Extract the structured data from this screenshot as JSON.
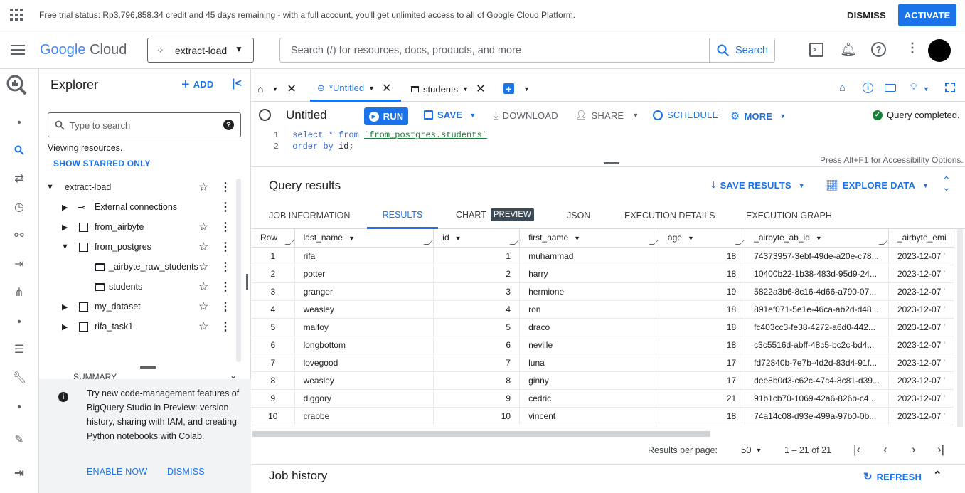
{
  "trial": {
    "text": "Free trial status: Rp3,796,858.34 credit and 45 days remaining - with a full account, you'll get unlimited access to all of Google Cloud Platform.",
    "dismiss": "DISMISS",
    "activate": "ACTIVATE"
  },
  "header": {
    "logo_google": "Google",
    "logo_cloud": "Cloud",
    "project": "extract-load",
    "search_placeholder": "Search (/) for resources, docs, products, and more",
    "search_button": "Search"
  },
  "explorer": {
    "title": "Explorer",
    "add": "ADD",
    "search_placeholder": "Type to search",
    "viewing": "Viewing resources.",
    "show_starred": "SHOW STARRED ONLY",
    "tree": [
      {
        "label": "extract-load"
      },
      {
        "label": "External connections"
      },
      {
        "label": "from_airbyte"
      },
      {
        "label": "from_postgres"
      },
      {
        "label": "_airbyte_raw_students"
      },
      {
        "label": "students"
      },
      {
        "label": "my_dataset"
      },
      {
        "label": "rifa_task1"
      }
    ],
    "summary": "SUMMARY",
    "promo": "Try new code-management features of BigQuery Studio in Preview: version history, sharing with IAM, and creating Python notebooks with Colab.",
    "enable_now": "ENABLE NOW",
    "promo_dismiss": "DISMISS"
  },
  "tabs": [
    {
      "label": "*Untitled"
    },
    {
      "label": "students"
    }
  ],
  "toolbar": {
    "title": "Untitled",
    "run": "RUN",
    "save": "SAVE",
    "download": "DOWNLOAD",
    "share": "SHARE",
    "schedule": "SCHEDULE",
    "more": "MORE",
    "status": "Query completed."
  },
  "editor": {
    "lines": [
      {
        "num": "1",
        "kw": "select * from ",
        "str": "`from_postgres.students`"
      },
      {
        "num": "2",
        "kw": "order by ",
        "str": "id;"
      }
    ],
    "a11y": "Press Alt+F1 for Accessibility Options."
  },
  "results": {
    "title": "Query results",
    "save_results": "SAVE RESULTS",
    "explore_data": "EXPLORE DATA",
    "tabs": [
      "JOB INFORMATION",
      "RESULTS",
      "CHART",
      "JSON",
      "EXECUTION DETAILS",
      "EXECUTION GRAPH"
    ],
    "preview_badge": "PREVIEW",
    "columns": [
      "Row",
      "last_name",
      "id",
      "first_name",
      "age",
      "_airbyte_ab_id",
      "_airbyte_emi"
    ],
    "rows": [
      [
        "1",
        "rifa",
        "1",
        "muhammad",
        "18",
        "74373957-3ebf-49de-a20e-c78...",
        "2023-12-07 '"
      ],
      [
        "2",
        "potter",
        "2",
        "harry",
        "18",
        "10400b22-1b38-483d-95d9-24...",
        "2023-12-07 '"
      ],
      [
        "3",
        "granger",
        "3",
        "hermione",
        "19",
        "5822a3b6-8c16-4d66-a790-07...",
        "2023-12-07 '"
      ],
      [
        "4",
        "weasley",
        "4",
        "ron",
        "18",
        "891ef071-5e1e-46ca-ab2d-d48...",
        "2023-12-07 '"
      ],
      [
        "5",
        "malfoy",
        "5",
        "draco",
        "18",
        "fc403cc3-fe38-4272-a6d0-442...",
        "2023-12-07 '"
      ],
      [
        "6",
        "longbottom",
        "6",
        "neville",
        "18",
        "c3c5516d-abff-48c5-bc2c-bd4...",
        "2023-12-07 '"
      ],
      [
        "7",
        "lovegood",
        "7",
        "luna",
        "17",
        "fd72840b-7e7b-4d2d-83d4-91f...",
        "2023-12-07 '"
      ],
      [
        "8",
        "weasley",
        "8",
        "ginny",
        "17",
        "dee8b0d3-c62c-47c4-8c81-d39...",
        "2023-12-07 '"
      ],
      [
        "9",
        "diggory",
        "9",
        "cedric",
        "21",
        "91b1cb70-1069-42a6-826b-c4...",
        "2023-12-07 '"
      ],
      [
        "10",
        "crabbe",
        "10",
        "vincent",
        "18",
        "74a14c08-d93e-499a-97b0-0b...",
        "2023-12-07 '"
      ]
    ],
    "per_page_label": "Results per page:",
    "per_page": "50",
    "range": "1 – 21 of 21"
  },
  "job_history": {
    "title": "Job history",
    "refresh": "REFRESH"
  },
  "colors": {
    "accent": "#1a73e8",
    "success": "#188038"
  }
}
